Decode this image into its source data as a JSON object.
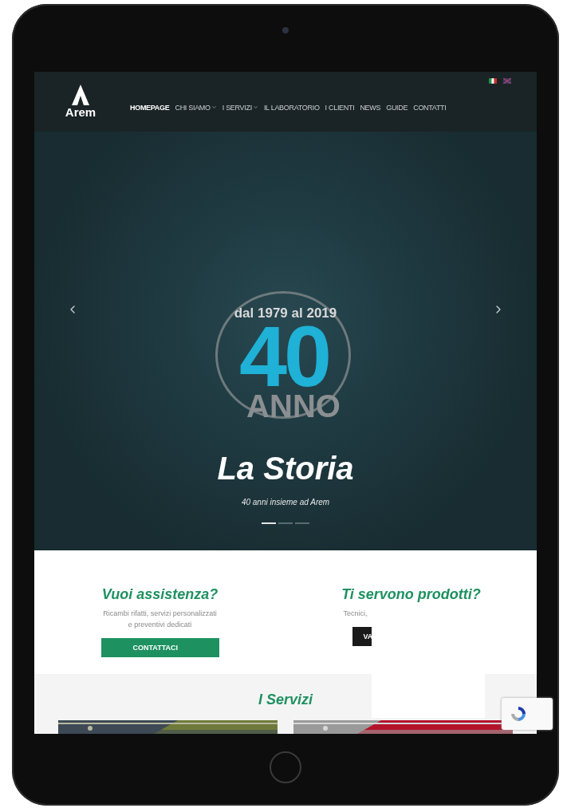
{
  "nav": {
    "logo": "Arem",
    "menu": [
      {
        "label": "HOMEPAGE",
        "selected": true,
        "dropdown": false
      },
      {
        "label": "CHI SIAMO",
        "selected": false,
        "dropdown": true
      },
      {
        "label": "I SERVIZI",
        "selected": false,
        "dropdown": true
      },
      {
        "label": "IL LABORATORIO",
        "selected": false,
        "dropdown": false
      },
      {
        "label": "I CLIENTI",
        "selected": false,
        "dropdown": false
      },
      {
        "label": "NEWS",
        "selected": false,
        "dropdown": false
      },
      {
        "label": "GUIDE",
        "selected": false,
        "dropdown": false
      },
      {
        "label": "CONTATTI",
        "selected": false,
        "dropdown": false
      }
    ]
  },
  "hero": {
    "badge_top": "dal 1979 al 2019",
    "badge_number": "40",
    "badge_bottom": "ANNO",
    "title": "La Storia",
    "subtitle": "40 anni insieme ad Arem",
    "dots": [
      {
        "selected": true
      },
      {
        "selected": false
      },
      {
        "selected": false
      }
    ]
  },
  "cta": [
    {
      "title": "Vuoi assistenza?",
      "text": "Ricambi rifatti, servizi personalizzati e preventivi dedicati",
      "button": "CONTATTACI",
      "kind": "green"
    },
    {
      "title": "Ti servono prodotti?",
      "text": "Tecnici,",
      "button": "VA",
      "kind": "dark"
    }
  ],
  "services": {
    "title": "I Servizi"
  }
}
